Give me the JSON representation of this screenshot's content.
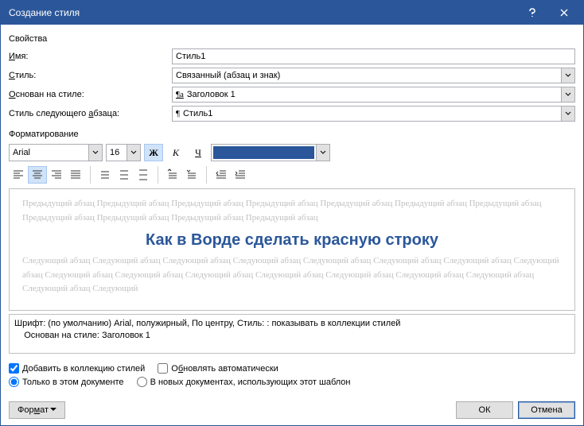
{
  "title": "Создание стиля",
  "section_properties": "Свойства",
  "section_formatting": "Форматирование",
  "labels": {
    "name": "Имя:",
    "name_u": "И",
    "style": "Стиль:",
    "style_u": "С",
    "based_on": "Основан на стиле:",
    "based_on_u": "О",
    "next_style_pre": "Стиль следующего ",
    "next_style_post": "бзаца:",
    "next_style_u": "а"
  },
  "values": {
    "name": "Стиль1",
    "style": "Связанный (абзац и знак)",
    "based_on": "Заголовок 1",
    "next_style": "Стиль1"
  },
  "font": {
    "name": "Arial",
    "size": "16",
    "bold": "Ж",
    "italic": "К",
    "underline": "Ч"
  },
  "preview": {
    "prev": "Предыдущий абзац Предыдущий абзац Предыдущий абзац Предыдущий абзац Предыдущий абзац Предыдущий абзац Предыдущий абзац Предыдущий абзац Предыдущий абзац Предыдущий абзац Предыдущий абзац",
    "main": "Как в Ворде сделать красную строку",
    "next": "Следующий абзац Следующий абзац Следующий абзац Следующий абзац Следующий абзац Следующий абзац Следующий абзац Следующий абзац Следующий абзац Следующий абзац Следующий абзац Следующий абзац Следующий абзац Следующий абзац Следующий абзац Следующий абзац Следующий"
  },
  "summary": {
    "line1": "Шрифт: (по умолчанию) Arial, полужирный, По центру, Стиль: : показывать в коллекции стилей",
    "line2": "    Основан на стиле: Заголовок 1"
  },
  "checks": {
    "add_to_gallery": "Добавить в коллекцию стилей",
    "add_u": "Д",
    "auto_update_pre": "О",
    "auto_update_post": "новлять автоматически",
    "auto_u": "б",
    "only_this_doc": "Только в этом документе",
    "in_new_docs": "В новых документах, использующих этот шаблон"
  },
  "buttons": {
    "format_pre": "Фор",
    "format_post": "ат",
    "format_u": "м",
    "ok": "ОК",
    "cancel": "Отмена"
  }
}
